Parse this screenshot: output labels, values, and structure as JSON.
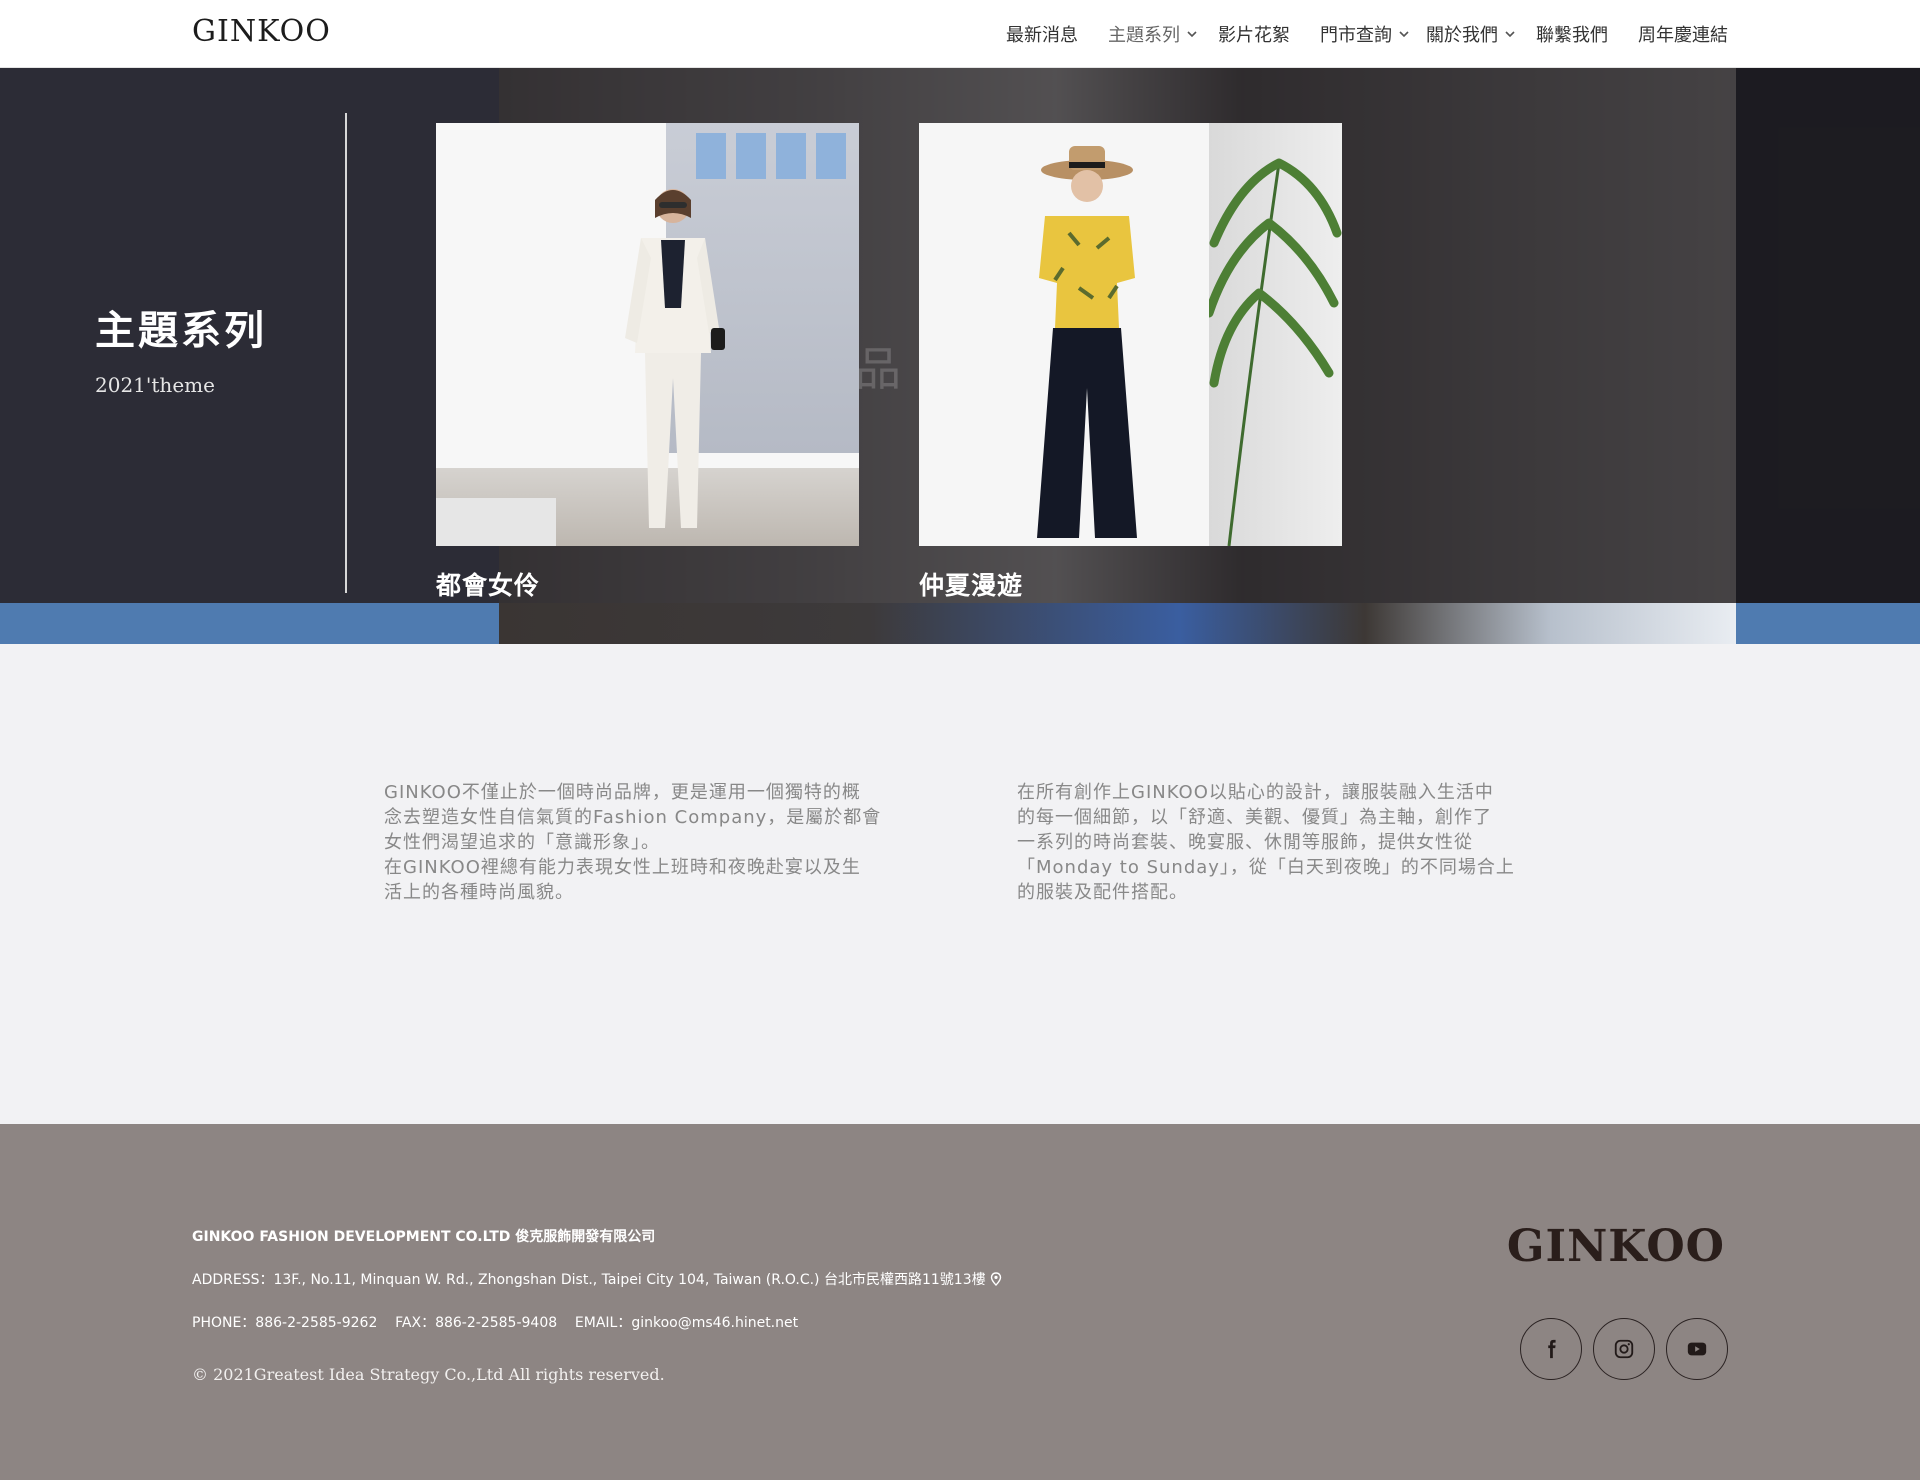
{
  "header": {
    "logo": "GINKOO",
    "nav": [
      {
        "label": "最新消息",
        "has_sub": false
      },
      {
        "label": "主題系列",
        "has_sub": true
      },
      {
        "label": "影片花絮",
        "has_sub": false
      },
      {
        "label": "門市查詢",
        "has_sub": true
      },
      {
        "label": "關於我們",
        "has_sub": true
      },
      {
        "label": "聯繫我們",
        "has_sub": false
      },
      {
        "label": "周年慶連結",
        "has_sub": false
      }
    ]
  },
  "hero": {
    "title": "主題系列",
    "subtitle": "2021'theme",
    "watermark": "品",
    "cards": [
      {
        "caption": "都會女伶"
      },
      {
        "caption": "仲夏漫遊"
      }
    ]
  },
  "about": {
    "left": [
      "GINKOO不僅止於一個時尚品牌，更是運用一個獨特的概",
      "念去塑造女性自信氣質的Fashion Company，是屬於都會",
      "女性們渴望追求的「意識形象」。",
      "在GINKOO裡總有能力表現女性上班時和夜晚赴宴以及生",
      "活上的各種時尚風貌。"
    ],
    "right": [
      "在所有創作上GINKOO以貼心的設計，讓服裝融入生活中",
      "的每一個細節，以「舒適、美觀、優質」為主軸，創作了",
      "一系列的時尚套裝、晚宴服、休閒等服飾，提供女性從",
      "「Monday to Sunday」，從「白天到夜晚」的不同場合上",
      "的服裝及配件搭配。"
    ]
  },
  "footer": {
    "company": "GINKOO FASHION DEVELOPMENT CO.LTD 俊克服飾開發有限公司",
    "address": "ADDRESS：13F., No.11, Minquan W. Rd., Zhongshan Dist., Taipei City 104, Taiwan (R.O.C.) 台北市民權西路11號13樓",
    "contact": "PHONE：886-2-2585-9262    FAX：886-2-2585-9408    EMAIL：ginkoo@ms46.hinet.net",
    "copyright": "© 2021Greatest Idea Strategy Co.,Ltd All rights reserved.",
    "logo": "GINKOO",
    "socials": [
      {
        "icon": "facebook-icon"
      },
      {
        "icon": "instagram-icon"
      },
      {
        "icon": "youtube-icon"
      }
    ]
  },
  "colors": {
    "header_bg": "#ffffff",
    "hero_dark": "#2c2c36",
    "hero_blue": "#4f7bb0",
    "about_bg": "#f2f2f4",
    "footer_bg": "#8d8583"
  }
}
